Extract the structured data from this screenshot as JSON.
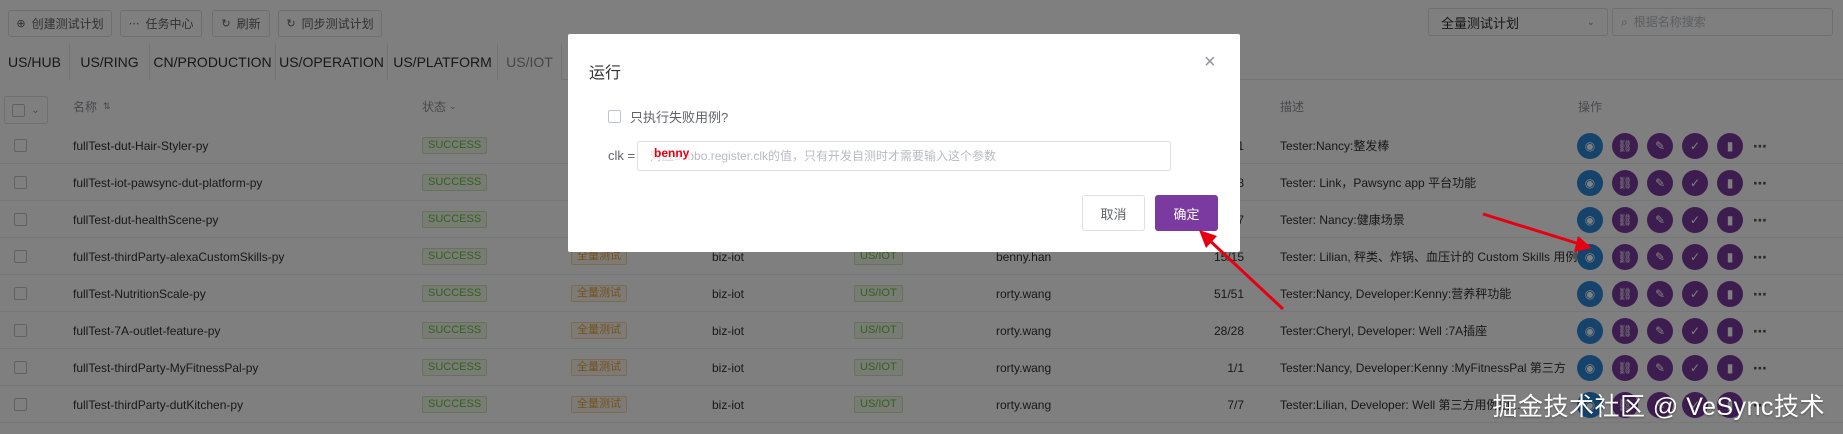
{
  "toolbar": {
    "create_plan": "创建测试计划",
    "task_center": "任务中心",
    "refresh": "刷新",
    "sync_plan": "同步测试计划",
    "plan_select": "全量测试计划",
    "search_placeholder": "根据名称搜索"
  },
  "tabs": [
    "US/HUB",
    "US/RING",
    "CN/PRODUCTION",
    "US/OPERATION",
    "US/PLATFORM",
    "US/IOT"
  ],
  "active_tab": "US/IOT",
  "columns": {
    "name": "名称",
    "status": "状态",
    "description": "描述",
    "actions": "操作"
  },
  "rows": [
    {
      "name": "fullTest-dut-Hair-Styler-py",
      "status": "SUCCESS",
      "plan": "",
      "group": "",
      "env": "",
      "owner": "",
      "ratio": "1",
      "desc": "Tester:Nancy:整发棒"
    },
    {
      "name": "fullTest-iot-pawsync-dut-platform-py",
      "status": "SUCCESS",
      "plan": "",
      "group": "",
      "env": "",
      "owner": "",
      "ratio": "8",
      "desc": "Tester: Link，Pawsync app 平台功能"
    },
    {
      "name": "fullTest-dut-healthScene-py",
      "status": "SUCCESS",
      "plan": "",
      "group": "",
      "env": "",
      "owner": "",
      "ratio": "7",
      "desc": "Tester: Nancy:健康场景"
    },
    {
      "name": "fullTest-thirdParty-alexaCustomSkills-py",
      "status": "SUCCESS",
      "plan": "全量测试",
      "group": "biz-iot",
      "env": "US/IOT",
      "owner": "benny.han",
      "ratio": "15/15",
      "desc": "Tester: Lilian, 秤类、炸锅、血压计的 Custom Skills 用例"
    },
    {
      "name": "fullTest-NutritionScale-py",
      "status": "SUCCESS",
      "plan": "全量测试",
      "group": "biz-iot",
      "env": "US/IOT",
      "owner": "rorty.wang",
      "ratio": "51/51",
      "desc": "Tester:Nancy, Developer:Kenny:营养秤功能"
    },
    {
      "name": "fullTest-7A-outlet-feature-py",
      "status": "SUCCESS",
      "plan": "全量测试",
      "group": "biz-iot",
      "env": "US/IOT",
      "owner": "rorty.wang",
      "ratio": "28/28",
      "desc": "Tester:Cheryl, Developer: Well :7A插座"
    },
    {
      "name": "fullTest-thirdParty-MyFitnessPal-py",
      "status": "SUCCESS",
      "plan": "全量测试",
      "group": "biz-iot",
      "env": "US/IOT",
      "owner": "rorty.wang",
      "ratio": "1/1",
      "desc": "Tester:Nancy, Developer:Kenny :MyFitnessPal 第三方"
    },
    {
      "name": "fullTest-thirdParty-dutKitchen-py",
      "status": "SUCCESS",
      "plan": "全量测试",
      "group": "biz-iot",
      "env": "US/IOT",
      "owner": "rorty.wang",
      "ratio": "7/7",
      "desc": "Tester:Lilian, Developer: Well 第三方用例厨..."
    }
  ],
  "dialog": {
    "title": "运行",
    "checkbox_label": "只执行失败用例?",
    "clk_label": "clk =",
    "clk_placeholder": "对应dubbo.register.clk的值，只有开发自测时才需要输入这个参数",
    "clk_annotation": "benny",
    "cancel": "取消",
    "confirm": "确定"
  },
  "watermark": "掘金技术社区 @ VeSync技术",
  "colors": {
    "primary_purple": "#7a3aa0",
    "action_blue": "#2a86d6",
    "success_green": "#67c23a",
    "plan_orange": "#e6a23c",
    "annotation_red": "#e60012"
  },
  "icons": {
    "create_plan": "plus-circle-icon",
    "task_center": "ellipsis-icon",
    "refresh": "refresh-icon",
    "sync_plan": "sync-icon",
    "row_actions": [
      "run-icon",
      "link-icon",
      "edit-icon",
      "check-icon",
      "chart-icon",
      "more-icon"
    ]
  }
}
